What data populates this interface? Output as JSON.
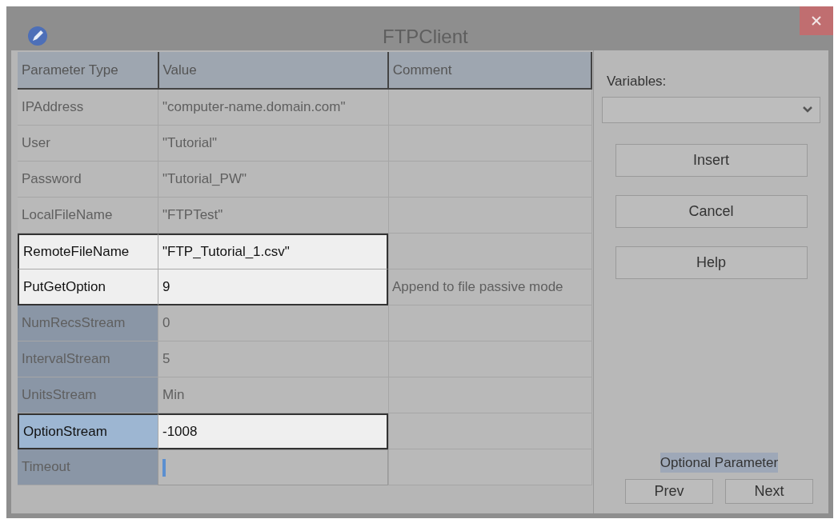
{
  "window": {
    "title": "FTPClient"
  },
  "table": {
    "columns": [
      "Parameter Type",
      "Value",
      "Comment"
    ],
    "rows": [
      {
        "parameter": "IPAddress",
        "value": "\"computer-name.domain.com\"",
        "comment": "",
        "optional": false,
        "highlighted": false,
        "selected": false,
        "editing": false
      },
      {
        "parameter": "User",
        "value": "\"Tutorial\"",
        "comment": "",
        "optional": false,
        "highlighted": false,
        "selected": false,
        "editing": false
      },
      {
        "parameter": "Password",
        "value": "\"Tutorial_PW\"",
        "comment": "",
        "optional": false,
        "highlighted": false,
        "selected": false,
        "editing": false
      },
      {
        "parameter": "LocalFileName",
        "value": "\"FTPTest\"",
        "comment": "",
        "optional": false,
        "highlighted": false,
        "selected": false,
        "editing": false
      },
      {
        "parameter": "RemoteFileName",
        "value": "\"FTP_Tutorial_1.csv\"",
        "comment": "",
        "optional": false,
        "highlighted": true,
        "selected": false,
        "editing": false
      },
      {
        "parameter": "PutGetOption",
        "value": "9",
        "comment": "Append to file passive mode",
        "optional": false,
        "highlighted": true,
        "selected": false,
        "editing": false
      },
      {
        "parameter": "NumRecsStream",
        "value": "0",
        "comment": "",
        "optional": true,
        "highlighted": false,
        "selected": false,
        "editing": false
      },
      {
        "parameter": "IntervalStream",
        "value": "5",
        "comment": "",
        "optional": true,
        "highlighted": false,
        "selected": false,
        "editing": false
      },
      {
        "parameter": "UnitsStream",
        "value": "Min",
        "comment": "",
        "optional": true,
        "highlighted": false,
        "selected": false,
        "editing": false
      },
      {
        "parameter": "OptionStream",
        "value": "-1008",
        "comment": "",
        "optional": true,
        "highlighted": true,
        "selected": true,
        "editing": false
      },
      {
        "parameter": "Timeout",
        "value": "",
        "comment": "",
        "optional": true,
        "highlighted": false,
        "selected": false,
        "editing": true
      }
    ]
  },
  "side_panel": {
    "variables_label": "Variables:",
    "buttons": [
      "Insert",
      "Cancel",
      "Help"
    ],
    "optional_label": "Optional Parameter",
    "nav_buttons": [
      "Prev",
      "Next"
    ]
  }
}
